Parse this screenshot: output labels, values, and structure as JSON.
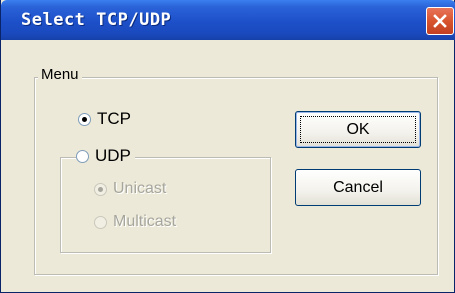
{
  "window": {
    "title": "Select TCP/UDP"
  },
  "menu_group": {
    "label": "Menu",
    "tcp_label": "TCP",
    "tcp_selected": true,
    "udp_label": "UDP",
    "udp_selected": false
  },
  "udp_group": {
    "unicast_label": "Unicast",
    "unicast_selected": true,
    "multicast_label": "Multicast",
    "multicast_selected": false,
    "enabled": false
  },
  "buttons": {
    "ok_label": "OK",
    "cancel_label": "Cancel"
  },
  "icons": {
    "close": "close-icon"
  },
  "colors": {
    "titlebar": "#1d50c9",
    "close_button": "#d8542f",
    "dialog_background": "#ece9d8",
    "disabled_text": "#a7a69c"
  }
}
